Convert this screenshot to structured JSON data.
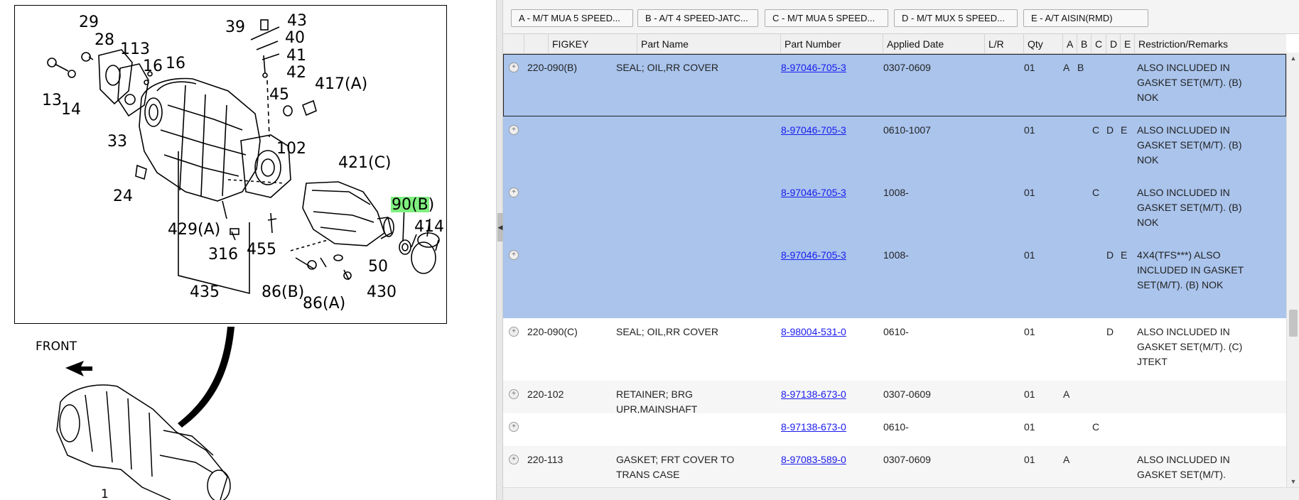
{
  "diagram": {
    "callouts": [
      "29",
      "28",
      "113",
      "16",
      "16",
      "13",
      "14",
      "33",
      "24",
      "39",
      "43",
      "40",
      "41",
      "42",
      "45",
      "417(A)",
      "102",
      "421(C)",
      "90(B)",
      "414",
      "429(A)",
      "316",
      "455",
      "50",
      "430",
      "435",
      "86(B)",
      "86(A)"
    ],
    "front_label": "FRONT",
    "bottom_callout": "1",
    "highlight_color": "#7ff07f"
  },
  "toolbar": {
    "tabs": [
      "A - M/T MUA 5 SPEED...",
      "B - A/T 4 SPEED-JATC...",
      "C - M/T MUA 5 SPEED...",
      "D - M/T MUX 5 SPEED...",
      "E - A/T AISIN(RMD)"
    ]
  },
  "grid": {
    "columns": [
      "FIGKEY",
      "Part Name",
      "Part Number",
      "Applied Date",
      "L/R",
      "Qty",
      "A",
      "B",
      "C",
      "D",
      "E",
      "Restriction/Remarks"
    ],
    "rows": [
      {
        "figkey": "220-090(B)",
        "name": "SEAL; OIL,RR COVER",
        "part": "8-97046-705-3",
        "date": "0307-0609",
        "lr": "",
        "qty": "01",
        "a": "A",
        "b": "B",
        "c": "",
        "d": "",
        "e": "",
        "remarks": "ALSO INCLUDED IN GASKET SET(M/T). (B) NOK"
      },
      {
        "figkey": "",
        "name": "",
        "part": "8-97046-705-3",
        "date": "0610-1007",
        "lr": "",
        "qty": "01",
        "a": "",
        "b": "",
        "c": "C",
        "d": "D",
        "e": "E",
        "remarks": "ALSO INCLUDED IN GASKET SET(M/T). (B) NOK"
      },
      {
        "figkey": "",
        "name": "",
        "part": "8-97046-705-3",
        "date": "1008-",
        "lr": "",
        "qty": "01",
        "a": "",
        "b": "",
        "c": "C",
        "d": "",
        "e": "",
        "remarks": "ALSO INCLUDED IN GASKET SET(M/T). (B) NOK"
      },
      {
        "figkey": "",
        "name": "",
        "part": "8-97046-705-3",
        "date": "1008-",
        "lr": "",
        "qty": "01",
        "a": "",
        "b": "",
        "c": "",
        "d": "D",
        "e": "E",
        "remarks": "4X4(TFS***) ALSO INCLUDED IN GASKET SET(M/T). (B) NOK"
      },
      {
        "figkey": "220-090(C)",
        "name": "SEAL; OIL,RR COVER",
        "part": "8-98004-531-0",
        "date": "0610-",
        "lr": "",
        "qty": "01",
        "a": "",
        "b": "",
        "c": "",
        "d": "D",
        "e": "",
        "remarks": "ALSO INCLUDED IN GASKET SET(M/T). (C) JTEKT"
      },
      {
        "figkey": "220-102",
        "name": "RETAINER; BRG UPR,MAINSHAFT",
        "part": "8-97138-673-0",
        "date": "0307-0609",
        "lr": "",
        "qty": "01",
        "a": "A",
        "b": "",
        "c": "",
        "d": "",
        "e": "",
        "remarks": ""
      },
      {
        "figkey": "",
        "name": "",
        "part": "8-97138-673-0",
        "date": "0610-",
        "lr": "",
        "qty": "01",
        "a": "",
        "b": "",
        "c": "C",
        "d": "",
        "e": "",
        "remarks": ""
      },
      {
        "figkey": "220-113",
        "name": "GASKET; FRT COVER TO TRANS CASE",
        "part": "8-97083-589-0",
        "date": "0307-0609",
        "lr": "",
        "qty": "01",
        "a": "A",
        "b": "",
        "c": "",
        "d": "",
        "e": "",
        "remarks": "ALSO INCLUDED IN GASKET SET(M/T)."
      }
    ]
  },
  "colors": {
    "selected_row": "#aac4ec",
    "link": "#1a1aee"
  }
}
